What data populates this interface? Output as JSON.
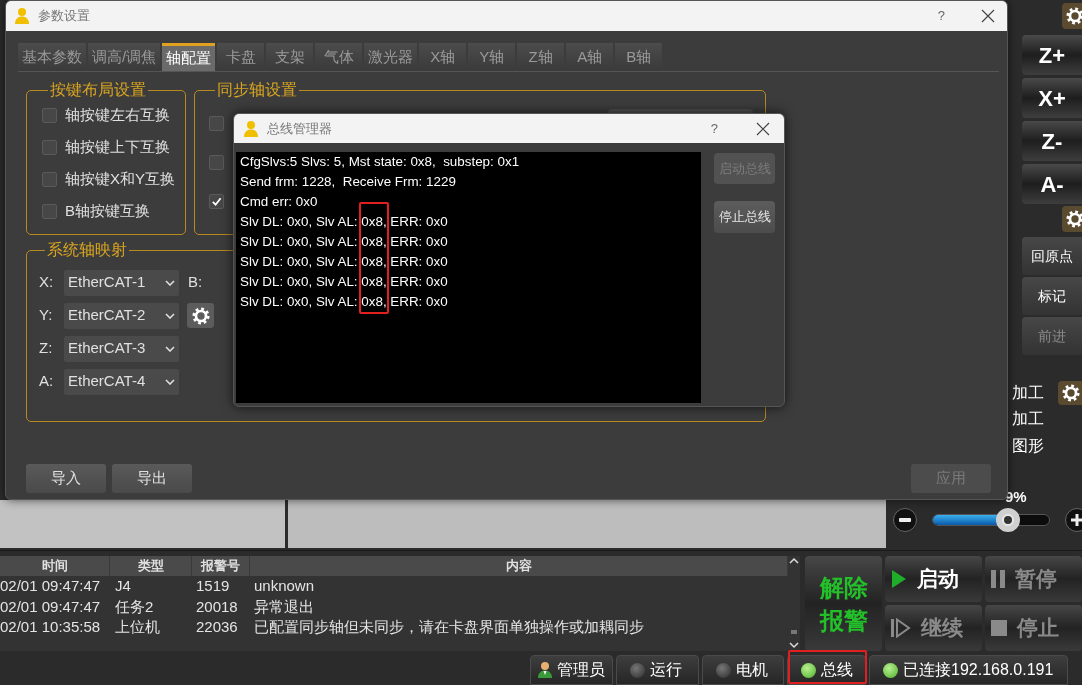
{
  "settings_dialog": {
    "title": "参数设置",
    "help": "?",
    "tabs": [
      {
        "label": "基本参数",
        "selected": false
      },
      {
        "label": "调高/调焦",
        "selected": false
      },
      {
        "label": "轴配置",
        "selected": true
      },
      {
        "label": "卡盘",
        "selected": false
      },
      {
        "label": "支架",
        "selected": false
      },
      {
        "label": "气体",
        "selected": false
      },
      {
        "label": "激光器",
        "selected": false
      },
      {
        "label": "X轴",
        "selected": false
      },
      {
        "label": "Y轴",
        "selected": false
      },
      {
        "label": "Z轴",
        "selected": false
      },
      {
        "label": "A轴",
        "selected": false
      },
      {
        "label": "B轴",
        "selected": false
      }
    ],
    "key_layout": {
      "title": "按键布局设置",
      "options": [
        {
          "label": "轴按键左右互换",
          "checked": false
        },
        {
          "label": "轴按键上下互换",
          "checked": false
        },
        {
          "label": "轴按键X和Y互换",
          "checked": false
        },
        {
          "label": "B轴按键互换",
          "checked": false
        }
      ]
    },
    "sync_axes": {
      "title": "同步轴设置",
      "options": [
        {
          "checked": false
        },
        {
          "checked": false
        },
        {
          "checked": true
        }
      ]
    },
    "axis_mapping": {
      "title": "系统轴映射",
      "side_label": "B:",
      "rows": [
        {
          "axis": "X:",
          "value": "EtherCAT-1"
        },
        {
          "axis": "Y:",
          "value": "EtherCAT-2"
        },
        {
          "axis": "Z:",
          "value": "EtherCAT-3"
        },
        {
          "axis": "A:",
          "value": "EtherCAT-4"
        }
      ]
    },
    "buttons": [
      {
        "label": "导入",
        "disabled": false
      },
      {
        "label": "导出",
        "disabled": false
      },
      {
        "label": "应用",
        "disabled": true
      }
    ]
  },
  "bus_dialog": {
    "title": "总线管理器",
    "help": "?",
    "console_lines": [
      "CfgSlvs:5 Slvs: 5, Mst state: 0x8,  substep: 0x1",
      "Send frm: 1228,  Receive Frm: 1229",
      "Cmd err: 0x0",
      "Slv DL: 0x0, Slv AL: 0x8, ERR: 0x0",
      "Slv DL: 0x0, Slv AL: 0x8, ERR: 0x0",
      "Slv DL: 0x0, Slv AL: 0x8, ERR: 0x0",
      "Slv DL: 0x0, Slv AL: 0x8, ERR: 0x0",
      "Slv DL: 0x0, Slv AL: 0x8, ERR: 0x0"
    ],
    "buttons": [
      {
        "label": "启动总线",
        "disabled": true
      },
      {
        "label": "停止总线",
        "disabled": false
      }
    ]
  },
  "right_panel": {
    "jog_buttons": [
      "Z+",
      "X+",
      "Z-",
      "A-"
    ],
    "action_buttons": [
      {
        "label": "回原点",
        "disabled": false
      },
      {
        "label": "标记",
        "disabled": false
      },
      {
        "label": "前进",
        "disabled": true
      }
    ],
    "options": [
      "加工",
      "加工",
      "图形"
    ],
    "speed": {
      "reading": "9%",
      "level": 0.64
    }
  },
  "alarm_log": {
    "columns": [
      "时间",
      "类型",
      "报警号",
      "内容"
    ],
    "rows": [
      [
        "02/01 09:47:47",
        "J4",
        "1519",
        "unknown"
      ],
      [
        "02/01 09:47:47",
        "任务2",
        "20018",
        "异常退出"
      ],
      [
        "02/01 10:35:58",
        "上位机",
        "22036",
        "已配置同步轴但未同步，请在卡盘界面单独操作或加耦同步"
      ]
    ]
  },
  "clear_alarm": "解除报警",
  "control_buttons": [
    {
      "label": "启动",
      "kind": "start",
      "disabled": false
    },
    {
      "label": "暂停",
      "kind": "pause",
      "disabled": true
    },
    {
      "label": "继续",
      "kind": "resume",
      "disabled": true
    },
    {
      "label": "停止",
      "kind": "stop",
      "disabled": true
    }
  ],
  "status_bar": {
    "user": "管理员",
    "indicators": [
      {
        "label": "运行",
        "on": false
      },
      {
        "label": "电机",
        "on": false
      },
      {
        "label": "总线",
        "on": true
      },
      {
        "label": "已连接192.168.0.191",
        "on": true
      }
    ]
  }
}
